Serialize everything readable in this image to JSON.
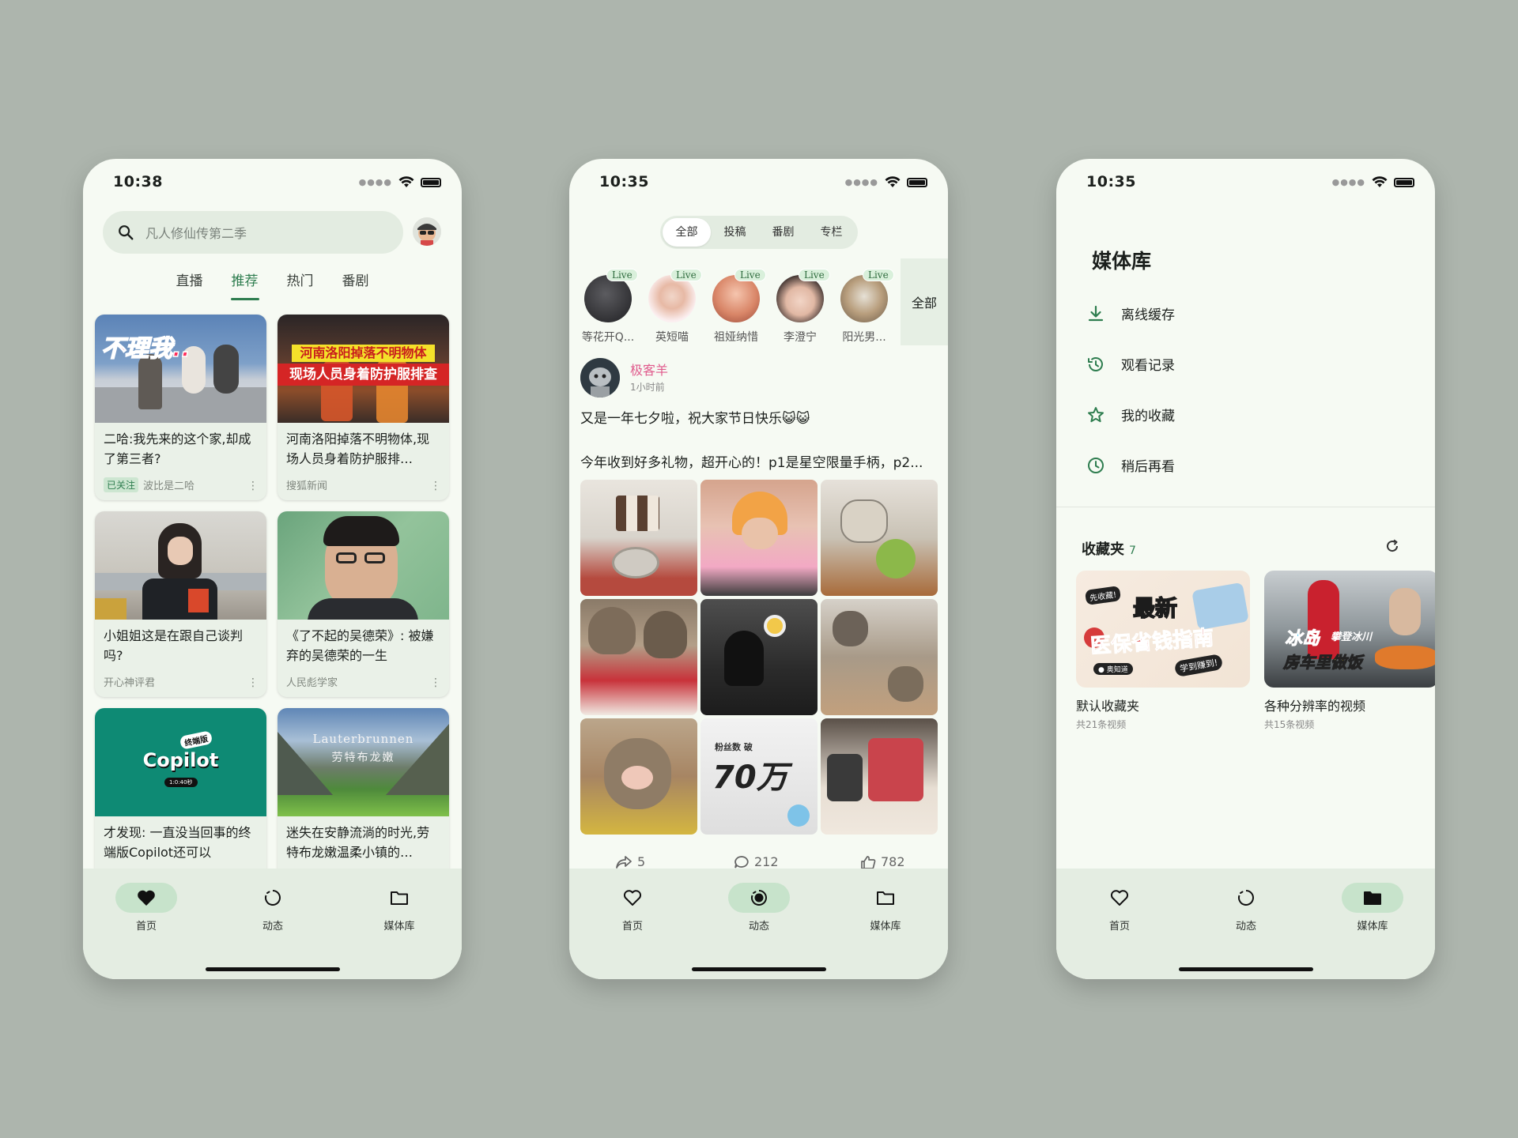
{
  "colors": {
    "accent": "#2e7d4f",
    "background": "#adb5ad",
    "nav_active": "#c7e3cb",
    "author": "#e05a8c"
  },
  "nav": {
    "home": "首页",
    "dynamic": "动态",
    "library": "媒体库"
  },
  "phone1": {
    "time": "10:38",
    "search_placeholder": "凡人修仙传第二季",
    "tabs": [
      "直播",
      "推荐",
      "热门",
      "番剧"
    ],
    "active_tab": "推荐",
    "cards": [
      {
        "title": "二哈:我先来的这个家,却成了第三者?",
        "tag": "已关注",
        "author": "波比是二哈",
        "overlay": "不理我.."
      },
      {
        "title": "河南洛阳掉落不明物体,现场人员身着防护服排…",
        "author": "搜狐新闻",
        "overlay_1": "河南洛阳掉落不明物体",
        "overlay_2": "现场人员身着防护服排查"
      },
      {
        "title": "小姐姐这是在跟自己谈判吗?",
        "author": "开心神评君"
      },
      {
        "title": "《了不起的吴德荣》: 被嫌弃的吴德荣的一生",
        "author": "人民彪学家"
      },
      {
        "title": "才发现: 一直没当回事的终端版Copilot还可以",
        "overlay_1": "终端版",
        "overlay_2": "Copilot",
        "overlay_3": "1:0:40秒"
      },
      {
        "title": "迷失在安静流淌的时光,劳特布龙嫩温柔小镇的…",
        "overlay_1": "Lauterbrunnen",
        "overlay_2": "劳特布龙嫩"
      }
    ]
  },
  "phone2": {
    "time": "10:35",
    "segments": [
      "全部",
      "投稿",
      "番剧",
      "专栏"
    ],
    "active_segment": "全部",
    "live_badge": "Live",
    "lives": [
      "等花开Q...",
      "英短喵",
      "祖娅纳惜",
      "李澄宁",
      "阳光男..."
    ],
    "all_label": "全部",
    "post": {
      "author": "极客羊",
      "time": "1小时前",
      "line1": "又是一年七夕啦，祝大家节日快乐😺😺",
      "line2": "今年收到好多礼物，超开心的！p1是星空限量手柄，p2...",
      "img_text_1": "粉丝数 破",
      "img_text_2": "70万",
      "shares": "5",
      "comments": "212",
      "likes": "782"
    }
  },
  "phone3": {
    "time": "10:35",
    "title": "媒体库",
    "items": [
      "离线缓存",
      "观看记录",
      "我的收藏",
      "稍后再看"
    ],
    "fav_title": "收藏夹",
    "fav_count": "7",
    "folders": [
      {
        "name": "默认收藏夹",
        "sub": "共21条视频",
        "overlay_1": "先收藏!",
        "overlay_2": "最新",
        "overlay_3": "医保省钱指南",
        "overlay_4": "学到赚到!",
        "overlay_5": "● 奥知道"
      },
      {
        "name": "各种分辨率的视频",
        "sub": "共15条视频",
        "overlay_1": "冰岛",
        "overlay_2": "攀登冰川",
        "overlay_3": "房车里做饭"
      }
    ]
  }
}
